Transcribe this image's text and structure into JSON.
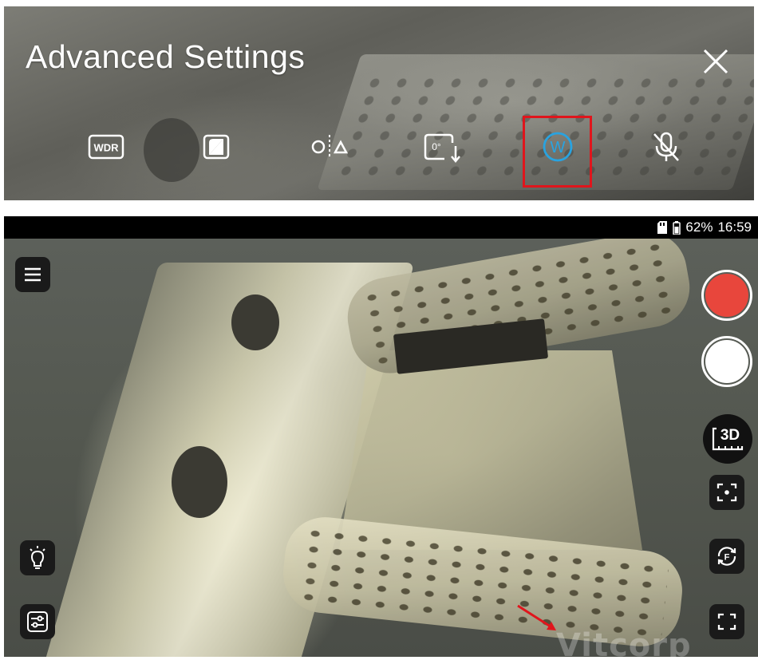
{
  "advanced_settings": {
    "title": "Advanced Settings",
    "close_icon": "close-icon",
    "buttons": [
      {
        "name": "wdr",
        "label": "WDR",
        "icon": "wdr-icon",
        "active": false
      },
      {
        "name": "image-adjust",
        "icon": "image-adjust-icon",
        "active": false
      },
      {
        "name": "mirror",
        "icon": "mirror-flip-icon",
        "active": false
      },
      {
        "name": "rotate",
        "label": "0°",
        "icon": "rotate-icon",
        "active": false
      },
      {
        "name": "white-balance",
        "label": "W",
        "icon": "white-balance-icon",
        "active": true
      },
      {
        "name": "mute",
        "icon": "microphone-off-icon",
        "active": false
      }
    ],
    "highlight_color": "#e0151c",
    "active_color": "#29a3e0"
  },
  "status_bar": {
    "battery": "62%",
    "time": "16:59"
  },
  "camera": {
    "watermark": "Vitcorp",
    "buttons": {
      "menu_icon": "menu-icon",
      "light_icon": "lightbulb-icon",
      "settings_icon": "sliders-icon",
      "record_color": "#e8463c",
      "measure_label": "3D",
      "focus_icon": "focus-frame-icon",
      "focus_label": "F",
      "fullscreen_icon": "fullscreen-icon"
    }
  }
}
